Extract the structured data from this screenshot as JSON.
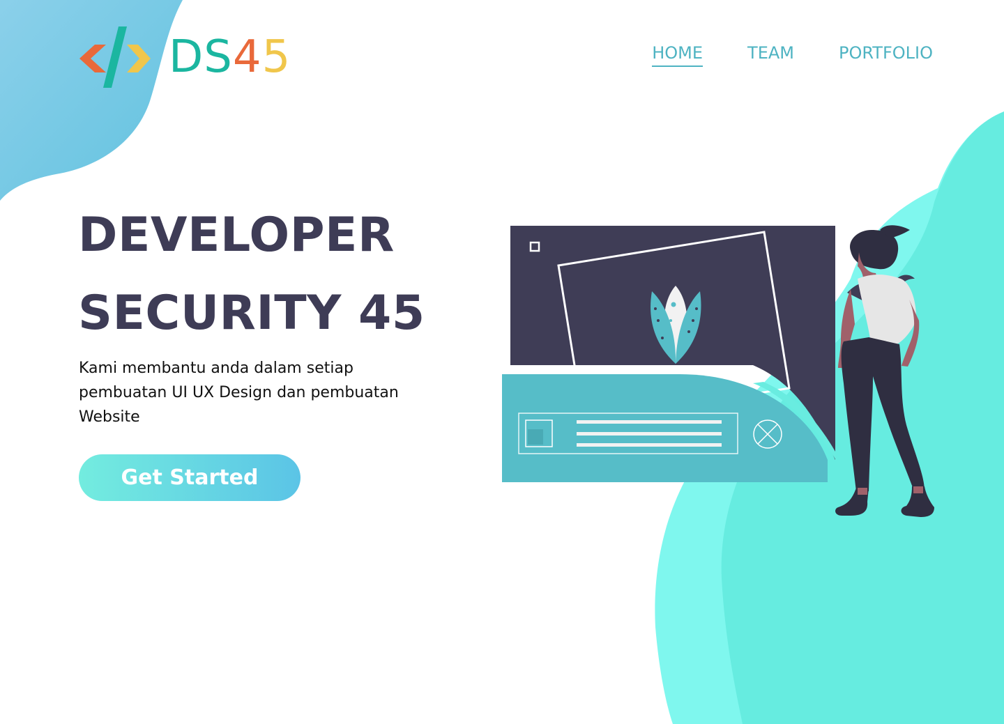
{
  "brand": {
    "name_part1": "DS",
    "name_part2": "4",
    "name_part3": "5",
    "colors": {
      "teal": "#1bb6a0",
      "orange": "#e9693a",
      "yellow": "#f0c64b"
    },
    "icon": "code-brackets-logo"
  },
  "nav": {
    "items": [
      {
        "label": "HOME",
        "active": true
      },
      {
        "label": "TEAM",
        "active": false
      },
      {
        "label": "PORTFOLIO",
        "active": false
      }
    ],
    "color": "#4eb3c2"
  },
  "hero": {
    "title_line1": "DEVELOPER",
    "title_line2": "SECURITY 45",
    "description": "Kami membantu anda dalam setiap pembuatan UI UX Design dan pembuatan Website",
    "cta_label": "Get Started",
    "title_color": "#3e3c56"
  },
  "illustration": {
    "icons": [
      "browser-window-illustration",
      "leaf-plant-icon",
      "close-circle-icon",
      "woman-figure-illustration"
    ],
    "colors": {
      "dark": "#3f3d56",
      "teal": "#56bdc8",
      "mint": "#69ece0"
    }
  }
}
